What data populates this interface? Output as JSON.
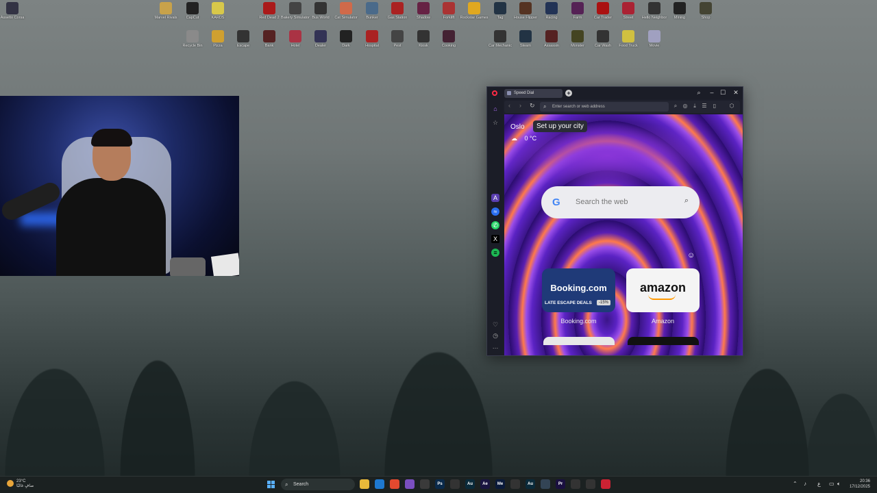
{
  "desktop": {
    "icons": [
      {
        "label": "Assetto Corsa",
        "icon": "game-icon",
        "color": "#333344"
      },
      {
        "label": "Marvel Rivals",
        "icon": "game-icon",
        "color": "#c8a24a"
      },
      {
        "label": "CapCut",
        "icon": "capcut-icon",
        "color": "#222222"
      },
      {
        "label": "KARDS",
        "icon": "game-icon",
        "color": "#d8c84a"
      },
      {
        "label": "Red Dead 2",
        "icon": "rdr2-icon",
        "color": "#aa1a1a"
      },
      {
        "label": "Bakery Simulator",
        "icon": "game-icon",
        "color": "#444444"
      },
      {
        "label": "Bus World",
        "icon": "game-icon",
        "color": "#333333"
      },
      {
        "label": "Cat Simulator",
        "icon": "game-icon",
        "color": "#d06a4a"
      },
      {
        "label": "Bunker",
        "icon": "game-icon",
        "color": "#4a6a8a"
      },
      {
        "label": "Gas Station",
        "icon": "game-icon",
        "color": "#aa2222"
      },
      {
        "label": "Shadow",
        "icon": "game-icon",
        "color": "#662244"
      },
      {
        "label": "Forklift",
        "icon": "game-icon",
        "color": "#aa3333"
      },
      {
        "label": "Rockstar Games",
        "icon": "rockstar-icon",
        "color": "#e0a820"
      },
      {
        "label": "Tag",
        "icon": "game-icon",
        "color": "#223344"
      },
      {
        "label": "House Flipper",
        "icon": "game-icon",
        "color": "#553322"
      },
      {
        "label": "Racing",
        "icon": "game-icon",
        "color": "#223355"
      },
      {
        "label": "Farm",
        "icon": "game-icon",
        "color": "#552255"
      },
      {
        "label": "Car Trader",
        "icon": "game-icon",
        "color": "#aa1111"
      },
      {
        "label": "Street",
        "icon": "game-icon",
        "color": "#aa2233"
      },
      {
        "label": "Hello Neighbor",
        "icon": "game-icon",
        "color": "#333333"
      },
      {
        "label": "Mining",
        "icon": "game-icon",
        "color": "#222222"
      },
      {
        "label": "Shop",
        "icon": "game-icon",
        "color": "#444433"
      },
      {
        "label": "Recycle Bin",
        "icon": "recycle-bin-icon",
        "color": "#8a8a8a"
      },
      {
        "label": "Pizza",
        "icon": "game-icon",
        "color": "#d0a030"
      },
      {
        "label": "Escape",
        "icon": "game-icon",
        "color": "#333333"
      },
      {
        "label": "Bank",
        "icon": "game-icon",
        "color": "#552222"
      },
      {
        "label": "Hotel",
        "icon": "game-icon",
        "color": "#aa3344"
      },
      {
        "label": "Dealer",
        "icon": "game-icon",
        "color": "#333355"
      },
      {
        "label": "Dark",
        "icon": "game-icon",
        "color": "#222222"
      },
      {
        "label": "Hospital",
        "icon": "game-icon",
        "color": "#aa2222"
      },
      {
        "label": "Pest",
        "icon": "game-icon",
        "color": "#444444"
      },
      {
        "label": "Kiosk",
        "icon": "game-icon",
        "color": "#333333"
      },
      {
        "label": "Cooking",
        "icon": "game-icon",
        "color": "#442233"
      },
      {
        "label": "Car Mechanic",
        "icon": "game-icon",
        "color": "#333333"
      },
      {
        "label": "Steam",
        "icon": "steam-icon",
        "color": "#223344"
      },
      {
        "label": "Assassin",
        "icon": "game-icon",
        "color": "#552222"
      },
      {
        "label": "Monster",
        "icon": "game-icon",
        "color": "#444422"
      },
      {
        "label": "Car Wash",
        "icon": "game-icon",
        "color": "#333333"
      },
      {
        "label": "Food Truck",
        "icon": "game-icon",
        "color": "#d0c040"
      },
      {
        "label": "Movie",
        "icon": "game-icon",
        "color": "#a0a0c0"
      }
    ]
  },
  "browser": {
    "tab_title": "Speed Dial",
    "new_tab_label": "+",
    "address_placeholder": "Enter search or web address",
    "weather": {
      "city": "Oslo",
      "setup_label": "Set up your city",
      "temp": "0 °C",
      "icon": "cloud-icon"
    },
    "search_placeholder": "Search the web",
    "speed_dial": [
      {
        "brand": "Booking.com",
        "promo": "LATE ESCAPE DEALS",
        "badge": "-15%",
        "label": "Booking.com"
      },
      {
        "brand": "amazon",
        "label": "Amazon"
      }
    ]
  },
  "taskbar": {
    "weather_temp": "23°C",
    "weather_desc": "صافٍ غالبًا",
    "search_label": "Search",
    "language": "ع",
    "time": "20:36",
    "date": "17/12/2025",
    "apps": [
      {
        "icon": "file-explorer-icon",
        "text": "",
        "color": "#e8b93a"
      },
      {
        "icon": "vscode-icon",
        "text": "",
        "color": "#1e78d0"
      },
      {
        "icon": "brave-icon",
        "text": "",
        "color": "#e2492f"
      },
      {
        "icon": "visual-studio-icon",
        "text": "",
        "color": "#7a4fc0"
      },
      {
        "icon": "notepad-icon",
        "text": "",
        "color": "#3a3a3a"
      },
      {
        "icon": "photoshop-icon",
        "text": "Ps",
        "color": "#0a2a4a"
      },
      {
        "icon": "capcut-icon",
        "text": "",
        "color": "#333333"
      },
      {
        "icon": "audition-icon",
        "text": "Au",
        "color": "#0a2a3a"
      },
      {
        "icon": "after-effects-icon",
        "text": "Ae",
        "color": "#1a1440"
      },
      {
        "icon": "media-encoder-icon",
        "text": "Me",
        "color": "#0a1a3a"
      },
      {
        "icon": "blender-icon",
        "text": "",
        "color": "#333333"
      },
      {
        "icon": "audition-icon",
        "text": "Au",
        "color": "#0a2a3a"
      },
      {
        "icon": "proton-icon",
        "text": "",
        "color": "#334455"
      },
      {
        "icon": "premiere-icon",
        "text": "Pr",
        "color": "#1a1040"
      },
      {
        "icon": "opera-icon",
        "text": "",
        "color": "#333333"
      },
      {
        "icon": "opera-gx-icon",
        "text": "",
        "color": "#333333"
      },
      {
        "icon": "record-icon",
        "text": "",
        "color": "#cc2233"
      }
    ]
  }
}
